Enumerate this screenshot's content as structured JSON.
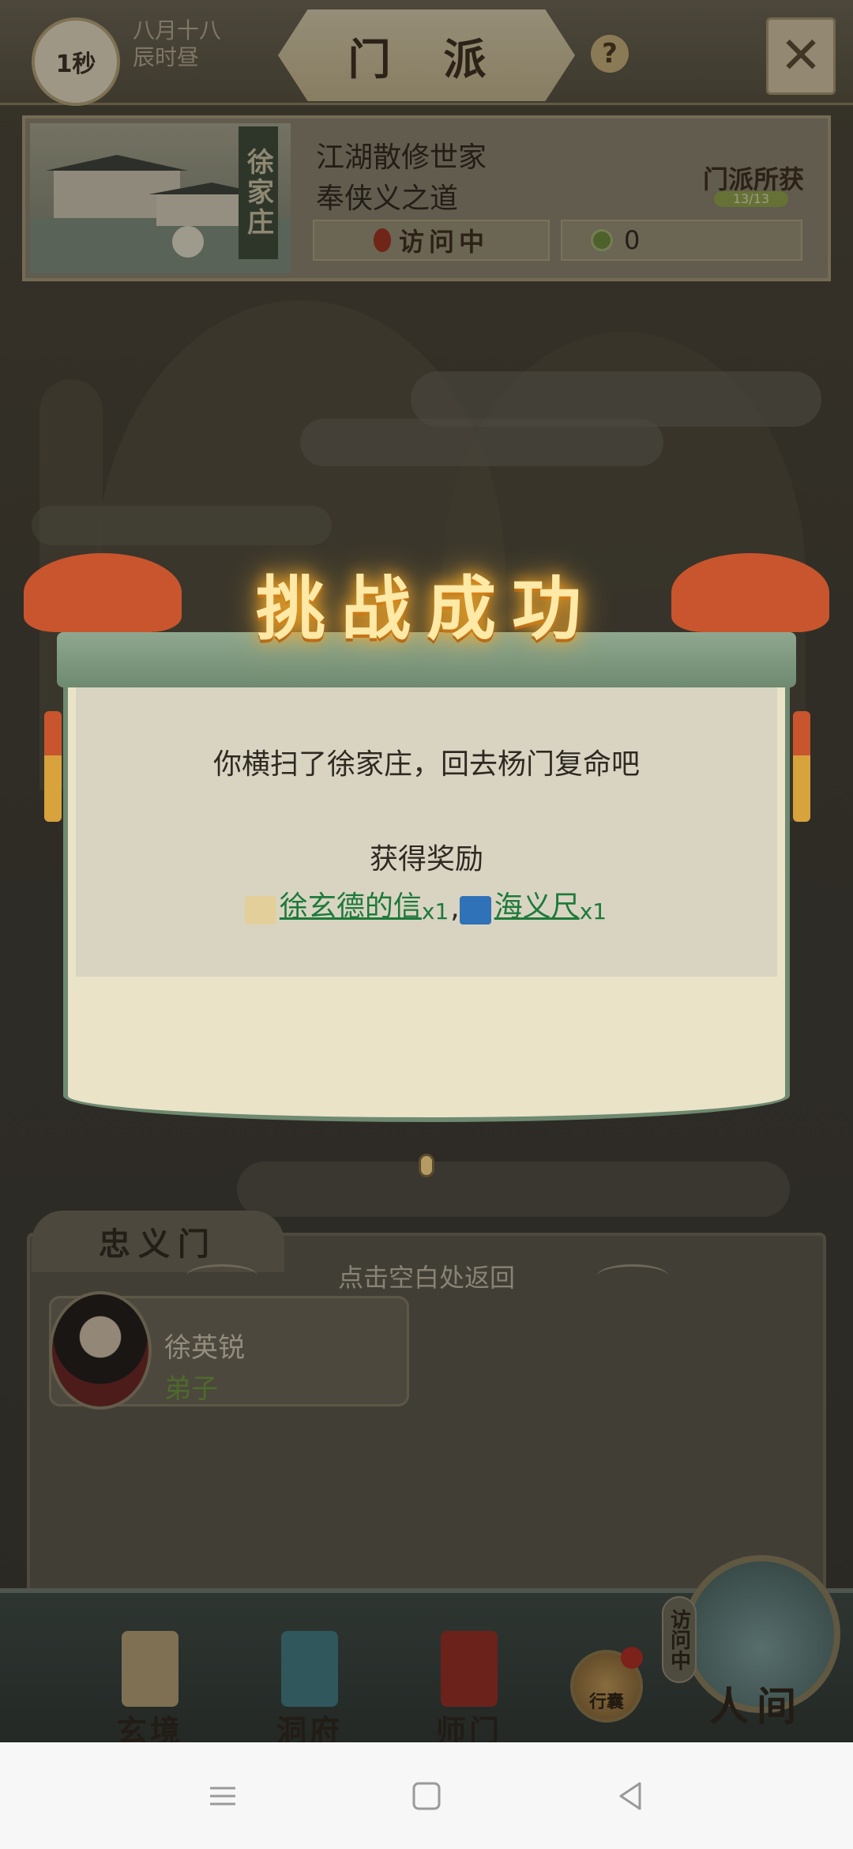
{
  "topbar": {
    "timer": "1秒",
    "lunar_date": "八月十八",
    "time_of_day": "辰时昼",
    "title": "门 派",
    "help": "?",
    "close_icon": "close-crossed-swords-icon"
  },
  "sect": {
    "name": "徐家庄",
    "type": "江湖散修世家",
    "motto": "奉侠义之道",
    "visit_status": "访问中",
    "coin_count": "0",
    "haul_label": "门派所获",
    "haul_progress_text": "13/13",
    "haul_fraction": 1.0
  },
  "popup": {
    "title": "挑战成功",
    "message": "你横扫了徐家庄，回去杨门复命吧",
    "reward_heading": "获得奖励",
    "rewards": [
      {
        "name": "徐玄德的信",
        "qty": "x1",
        "sep": ",",
        "icon": "letter-scroll-icon"
      },
      {
        "name": "海义尺",
        "qty": "x1",
        "sep": "",
        "icon": "ruler-weapon-icon"
      }
    ]
  },
  "sect_panel": {
    "tab": "忠义门",
    "return_hint": "点击空白处返回",
    "member": {
      "name": "徐英锐",
      "role": "弟子"
    }
  },
  "bottom_nav": {
    "items": [
      {
        "label": "玄境",
        "icon": "scroll-icon"
      },
      {
        "label": "洞府",
        "icon": "pavilion-icon"
      },
      {
        "label": "师门",
        "icon": "banner-icon"
      }
    ],
    "pack": "行囊",
    "world": "人间",
    "world_visit_tag": "访问中"
  },
  "colors": {
    "accent_green": "#1d7a3a",
    "title_gold": "#ffe9a6",
    "ribbon_red": "#c8552d"
  }
}
